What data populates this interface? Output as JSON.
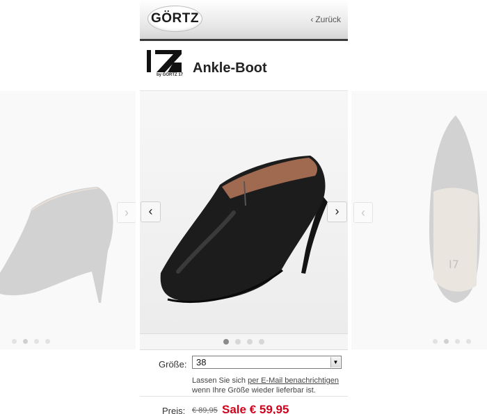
{
  "header": {
    "logo_text": "GÖRTZ",
    "back_label": "Zurück"
  },
  "product": {
    "brand_mark": "I7",
    "brand_sub": "by GÖRTZ 17",
    "title": "Ankle-Boot"
  },
  "gallery": {
    "prev_icon": "chevron-left-icon",
    "next_icon": "chevron-right-icon",
    "dot_count": 4,
    "active_index": 0
  },
  "size": {
    "label": "Größe:",
    "selected": "38",
    "notify_prefix": "Lassen Sie sich ",
    "notify_link": "per E-Mail benachrichtigen",
    "notify_suffix": "wenn Ihre Größe wieder lieferbar ist."
  },
  "price": {
    "label": "Preis:",
    "old": "€ 89,95",
    "sale": "Sale € 59,95"
  },
  "colors": {
    "sale_red": "#d0021b",
    "header_rule": "#3a3a3a"
  }
}
